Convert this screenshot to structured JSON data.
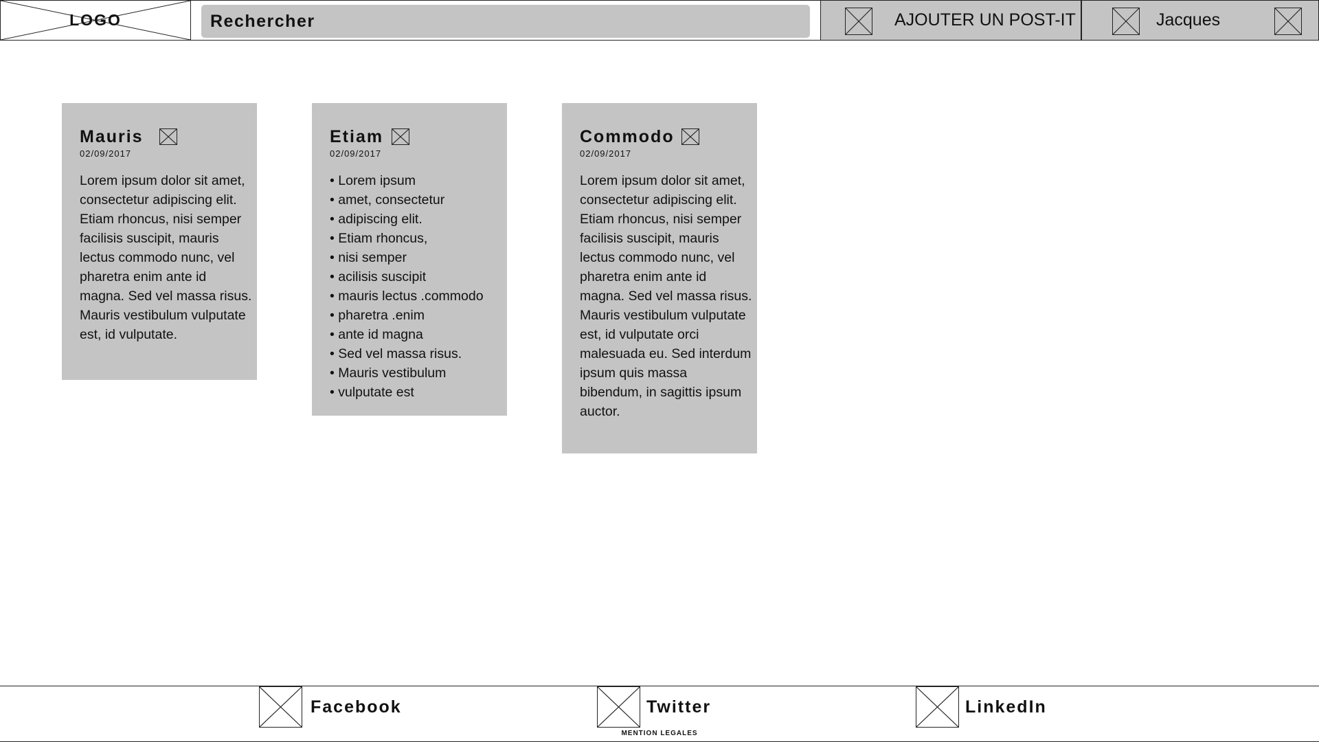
{
  "header": {
    "logo_text": "LOGO",
    "search_placeholder": "Rechercher",
    "add_postit_label": "AJOUTER UN POST-IT",
    "user_name": "Jacques"
  },
  "postits": [
    {
      "title": "Mauris",
      "date": "02/09/2017",
      "body": "Lorem ipsum dolor sit amet, consectetur adipiscing elit. Etiam rhoncus, nisi semper facilisis suscipit, mauris lectus commodo nunc, vel pharetra enim ante id magna. Sed vel massa risus. Mauris vestibulum vulputate est, id vulputate."
    },
    {
      "title": "Etiam",
      "date": "02/09/2017",
      "items": [
        "Lorem ipsum",
        "amet, consectetur",
        "adipiscing elit.",
        "Etiam rhoncus,",
        "nisi semper",
        "acilisis suscipit",
        "mauris lectus .commodo",
        "pharetra .enim",
        "ante id magna",
        "Sed vel massa risus.",
        "Mauris vestibulum",
        "vulputate est"
      ]
    },
    {
      "title": "Commodo",
      "date": "02/09/2017",
      "body": "Lorem ipsum dolor sit amet, consectetur adipiscing elit. Etiam rhoncus, nisi semper facilisis suscipit, mauris lectus commodo nunc, vel pharetra enim ante id magna. Sed vel massa risus. Mauris vestibulum vulputate est, id vulputate orci malesuada eu. Sed interdum ipsum quis massa bibendum, in sagittis ipsum auctor."
    }
  ],
  "footer": {
    "social": [
      {
        "label": "Facebook",
        "icon": "facebook-icon"
      },
      {
        "label": "Twitter",
        "icon": "twitter-icon"
      },
      {
        "label": "LinkedIn",
        "icon": "linkedin-icon"
      }
    ],
    "mentions": "MENTION LEGALES"
  },
  "colors": {
    "panel_gray": "#c4c4c4",
    "border": "#222222",
    "text": "#111111"
  }
}
